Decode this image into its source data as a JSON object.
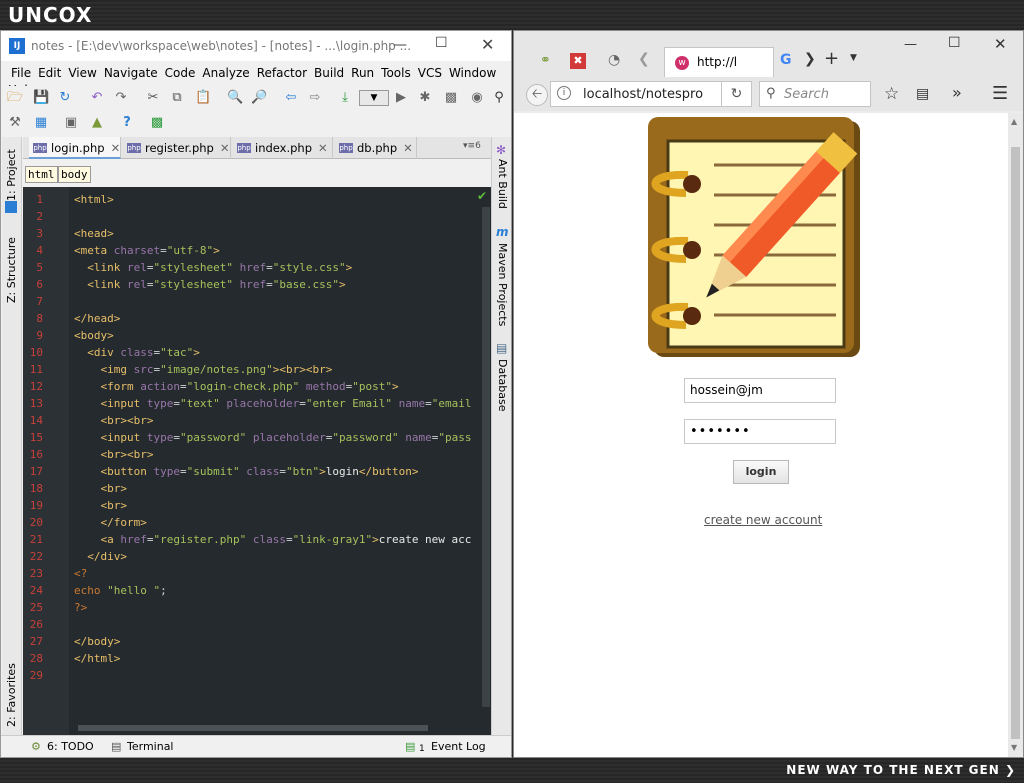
{
  "desktop": {
    "logo": "UNCOX",
    "slogan": "NEW WAY TO THE NEXT GEN ❯"
  },
  "ide": {
    "title": "notes - [E:\\dev\\workspace\\web\\notes] - [notes] - ...\\login.php ...",
    "menu": [
      "File",
      "Edit",
      "View",
      "Navigate",
      "Code",
      "Analyze",
      "Refactor",
      "Build",
      "Run",
      "Tools",
      "VCS",
      "Window",
      "Help"
    ],
    "left_tools": {
      "project": "1: Project",
      "structure": "Z: Structure",
      "favorites": "2: Favorites"
    },
    "right_tools": {
      "ant": "Ant Build",
      "maven": "Maven Projects",
      "database": "Database"
    },
    "tabs": [
      {
        "label": "login.php",
        "active": true
      },
      {
        "label": "register.php",
        "active": false
      },
      {
        "label": "index.php",
        "active": false
      },
      {
        "label": "db.php",
        "active": false
      }
    ],
    "tab_overflow": "6",
    "breadcrumbs": [
      "html",
      "body"
    ],
    "line_numbers": [
      "1",
      "2",
      "3",
      "4",
      "5",
      "6",
      "7",
      "8",
      "9",
      "10",
      "11",
      "12",
      "13",
      "14",
      "15",
      "16",
      "17",
      "18",
      "19",
      "20",
      "21",
      "22",
      "23",
      "24",
      "25",
      "26",
      "27",
      "28",
      "29"
    ],
    "code_lines": [
      "<html>",
      "",
      "<head>",
      "<meta charset=\"utf-8\">",
      "  <link rel=\"stylesheet\" href=\"style.css\">",
      "  <link rel=\"stylesheet\" href=\"base.css\">",
      "",
      "</head>",
      "<body>",
      "  <div class=\"tac\">",
      "    <img src=\"image/notes.png\"><br><br>",
      "    <form action=\"login-check.php\" method=\"post\">",
      "    <input type=\"text\" placeholder=\"enter Email\" name=\"email",
      "    <br><br>",
      "    <input type=\"password\" placeholder=\"password\" name=\"pass",
      "    <br><br>",
      "    <button type=\"submit\" class=\"btn\">login</button>",
      "    <br>",
      "    <br>",
      "    </form>",
      "    <a href=\"register.php\" class=\"link-gray1\">create new acc",
      "  </div>",
      "<?",
      "echo \"hello \";",
      "?>",
      "",
      "</body>",
      "</html>",
      ""
    ],
    "status": {
      "todo": "6: TODO",
      "terminal": "Terminal",
      "event_log": "Event Log",
      "event_count": "1"
    }
  },
  "browser": {
    "tab_url": "http://l",
    "address": "localhost/notespro",
    "search_placeholder": "Search",
    "page": {
      "email_value": "hossein@jm",
      "password_value": "•••••••",
      "login_label": "login",
      "register_link": "create new account"
    }
  }
}
